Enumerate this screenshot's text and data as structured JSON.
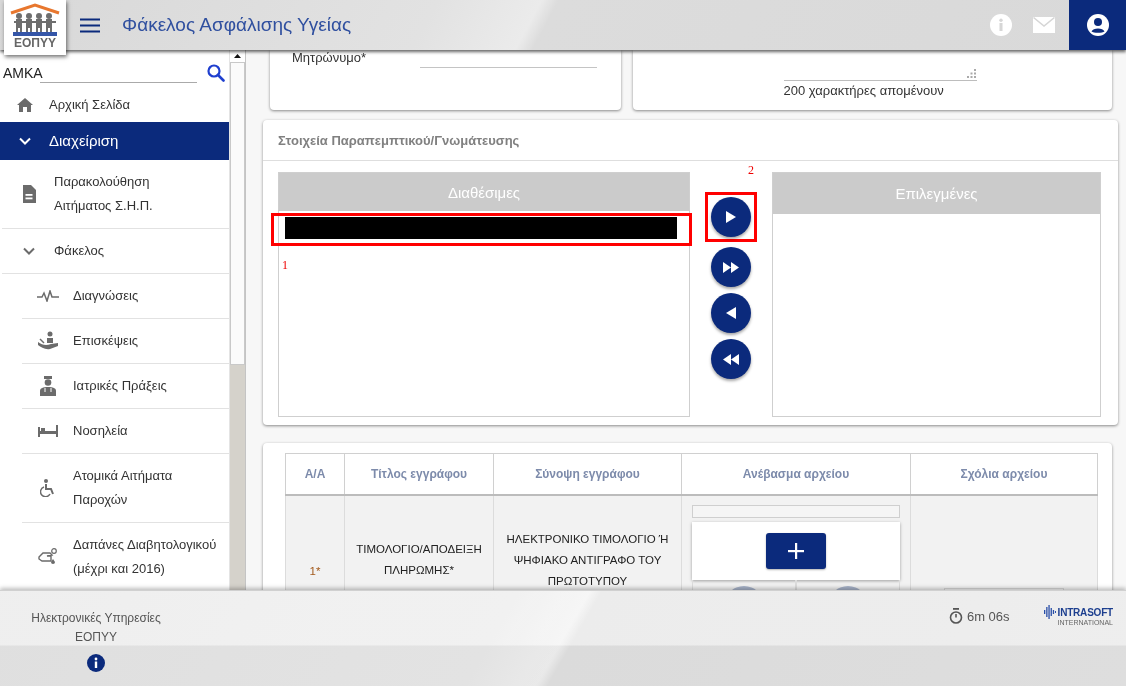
{
  "header": {
    "logo_text": "ΕΟΠΥΥ",
    "title": "Φάκελος Ασφάλισης Υγείας"
  },
  "sidebar": {
    "search": {
      "label": "ΑΜΚΑ"
    },
    "items": [
      {
        "label": "Αρχική Σελίδα",
        "selected": false
      },
      {
        "label": "Διαχείριση",
        "selected": true,
        "expanded": true,
        "children": [
          {
            "label": "Παρακολούθηση Αιτήματος Σ.Η.Π.",
            "selected": false
          },
          {
            "label": "Φάκελος",
            "selected": false,
            "expanded": true,
            "children": [
              {
                "label": "Διαγνώσεις",
                "selected": false
              },
              {
                "label": "Επισκέψεις",
                "selected": false
              },
              {
                "label": "Ιατρικές Πράξεις",
                "selected": false
              },
              {
                "label": "Νοσηλεία",
                "selected": false
              },
              {
                "label": "Ατομικά Αιτήματα Παροχών",
                "selected": false
              },
              {
                "label": "Δαπάνες Διαβητολογικού (μέχρι και 2016)",
                "selected": false
              }
            ]
          }
        ]
      }
    ]
  },
  "personal_card": {
    "field": {
      "label": "Μητρώνυμο*"
    }
  },
  "notes_card": {
    "counter": "200 χαρακτήρες απομένουν"
  },
  "referral": {
    "title": "Στοιχεία Παραπεμπτικού/Γνωμάτευσης",
    "available": {
      "header": "Διαθέσιμες",
      "items": [
        {
          "kind": "redacted",
          "annotation": "1"
        }
      ]
    },
    "transfer_buttons": [
      {
        "kind": "move-selected",
        "annotation": "2"
      },
      {
        "kind": "move-all"
      },
      {
        "kind": "remove-selected"
      },
      {
        "kind": "remove-all"
      }
    ],
    "chosen": {
      "header": "Επιλεγμένες"
    }
  },
  "documents": {
    "columns": [
      "Α/Α",
      "Τίτλος εγγράφου",
      "Σύνοψη εγγράφου",
      "Ανέβασμα αρχείου",
      "Σχόλια αρχείου"
    ],
    "rows": [
      {
        "number": "1*",
        "title": "ΤΙΜΟΛΟΓΙΟ/ΑΠΟΔΕΙΞΗ ΠΛΗΡΩΜΗΣ*",
        "summary": "ΗΛΕΚΤΡΟΝΙΚΟ ΤΙΜΟΛΟΓΙΟ Ή ΨΗΦΙΑΚΟ ΑΝΤΙΓΡΑΦΟ ΤΟΥ ΠΡΩΤΟΤΥΠΟΥ",
        "upload": {
          "level": 0
        }
      }
    ]
  },
  "footer": {
    "text": "Ηλεκτρονικές Υπηρεσίες ΕΟΠΥΥ",
    "session_timer": "6m 06s",
    "vendor": {
      "name": "INTRASOFT",
      "tagline": "INTERNATIONAL"
    }
  }
}
